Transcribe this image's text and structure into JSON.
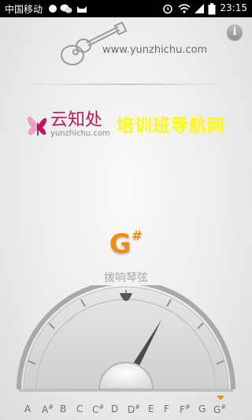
{
  "status_bar": {
    "carrier": "中国移动",
    "time": "23:15",
    "icons": [
      "wechat-icon",
      "chat-bubble-icon",
      "cat-icon",
      "alarm-icon",
      "wifi-icon",
      "signal-icon",
      "battery-icon"
    ]
  },
  "header": {
    "website": "www.yunzhichu.com",
    "info_label": "i",
    "icon": "guitar-icon"
  },
  "logo": {
    "name_cn": "云知处",
    "name_en": "yunzhichu.com",
    "icon": "butterfly-icon"
  },
  "promo_text": "培训班导航网",
  "tuner": {
    "current_note": "G",
    "current_sharp": "#",
    "hint": "拨响琴弦",
    "needle_position": 0.82,
    "accent_color": "#f28b14"
  },
  "notes": [
    "A",
    "A#",
    "B",
    "C",
    "C#",
    "D",
    "D#",
    "E",
    "F",
    "F#",
    "G",
    "G#"
  ],
  "selected_note_index": 11
}
